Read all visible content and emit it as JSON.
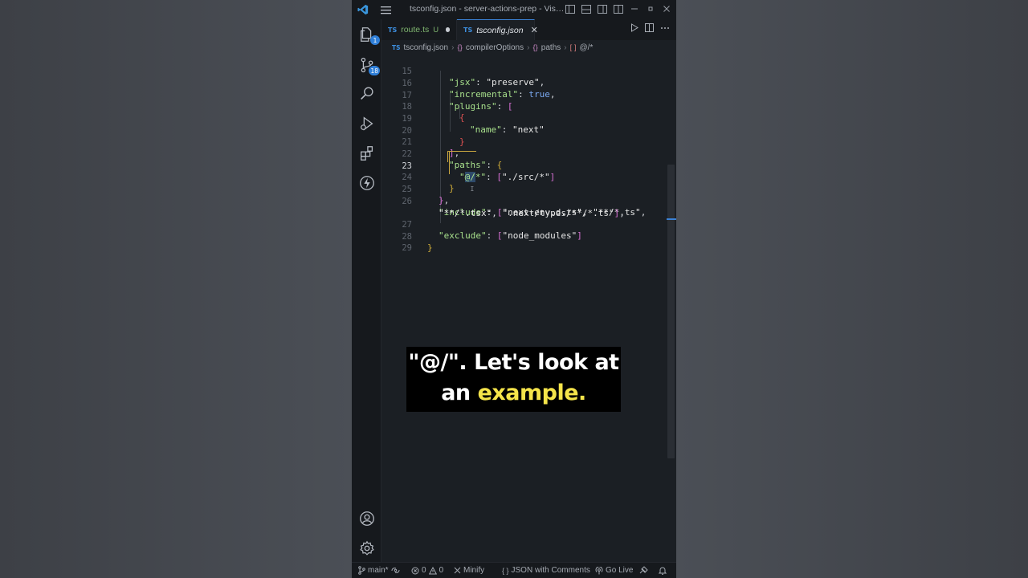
{
  "window": {
    "title": "tsconfig.json - server-actions-prep - Visual St..."
  },
  "tabs": [
    {
      "label": "route.ts",
      "lang": "TS",
      "status": "U",
      "active": false,
      "modified": true
    },
    {
      "label": "tsconfig.json",
      "lang": "TS",
      "active": true
    }
  ],
  "activity": {
    "explorer_badge": "1",
    "scm_badge": "18"
  },
  "breadcrumb": {
    "file": "tsconfig.json",
    "segment1_icon": "{}",
    "segment1": "compilerOptions",
    "segment2_icon": "{}",
    "segment2": "paths",
    "segment3_icon": "[ ]",
    "segment3": "@/*"
  },
  "editor": {
    "current_line": 23,
    "lines": [
      {
        "n": "15",
        "text": "\"jsx\": \"preserve\","
      },
      {
        "n": "16",
        "text": "\"incremental\": true,"
      },
      {
        "n": "17",
        "text": "\"plugins\": ["
      },
      {
        "n": "18",
        "text": "{"
      },
      {
        "n": "19",
        "text": "\"name\": \"next\""
      },
      {
        "n": "20",
        "text": "}"
      },
      {
        "n": "21",
        "text": "],"
      },
      {
        "n": "22",
        "text": "\"paths\": {"
      },
      {
        "n": "23",
        "text": "\"@/*\": [\"./src/*\"]"
      },
      {
        "n": "24",
        "text": "}"
      },
      {
        "n": "25",
        "text": "},"
      },
      {
        "n": "26",
        "text": "\"include\": [\"next-env.d.ts\", \"**/*.ts\", \"**/*.tsx\", \".next/types/**/*.ts\"],"
      },
      {
        "n": "27",
        "text": "\"exclude\": [\"node_modules\"]"
      },
      {
        "n": "28",
        "text": "}"
      },
      {
        "n": "29",
        "text": ""
      }
    ]
  },
  "caption": {
    "line1": "\"@/\".  Let's look at",
    "line2_plain": "an",
    "line2_highlight": "example.",
    "highlight_color": "#f5e44a"
  },
  "statusbar": {
    "branch": "main*",
    "errors": "0",
    "warnings": "0",
    "minify": "Minify",
    "language": "JSON with Comments",
    "golive": "Go Live"
  },
  "colors": {
    "accent": "#3b82d6",
    "key": "#a8e08c",
    "bracket_gold": "#d4b03a",
    "bracket_purple": "#da70d6",
    "bracket_red": "#e05252"
  }
}
